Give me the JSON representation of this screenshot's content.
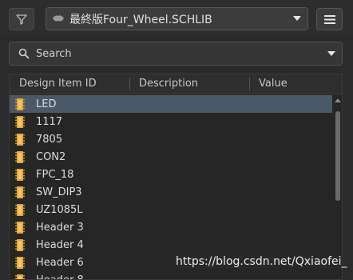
{
  "toolbar": {
    "filter_icon": "funnel-icon",
    "library_name": "最終版Four_Wheel.SCHLIB",
    "library_icon": "library-icon",
    "menu_icon": "hamburger-icon"
  },
  "search": {
    "label": "Search"
  },
  "table": {
    "columns": [
      "Design Item ID",
      "Description",
      "Value"
    ],
    "rows": [
      {
        "id": "LED",
        "selected": true
      },
      {
        "id": "1117"
      },
      {
        "id": "7805"
      },
      {
        "id": "CON2"
      },
      {
        "id": "FPC_18"
      },
      {
        "id": "SW_DIP3"
      },
      {
        "id": "UZ1085L"
      },
      {
        "id": "Header 3"
      },
      {
        "id": "Header 4"
      },
      {
        "id": "Header 6"
      },
      {
        "id": "Header 8"
      }
    ]
  },
  "watermark": "https://blog.csdn.net/Qxiaofei_",
  "colors": {
    "background": "#2b2b2b",
    "selected_row": "#4a5868",
    "component_chip": "#e0a93a"
  }
}
